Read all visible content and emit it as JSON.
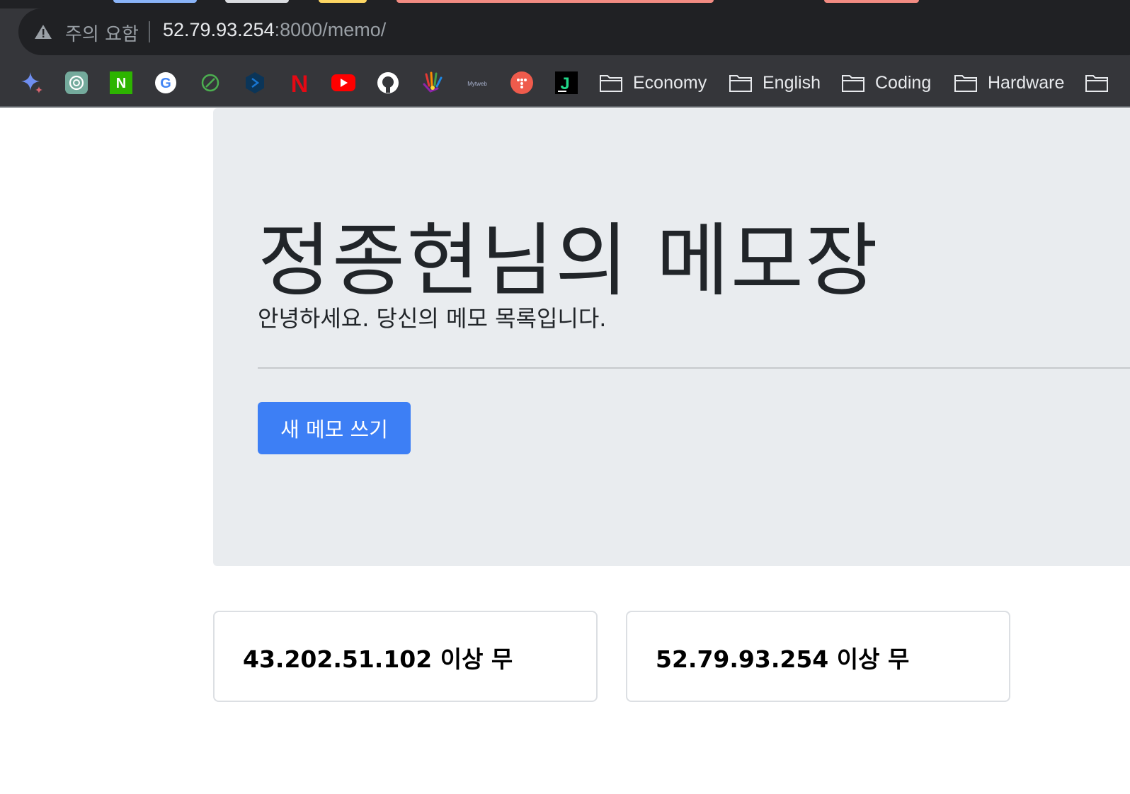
{
  "browser": {
    "security_label": "주의 요함",
    "url_host": "52.79.93.254",
    "url_path": ":8000/memo/",
    "bookmark_folders": [
      {
        "label": "Economy"
      },
      {
        "label": "English"
      },
      {
        "label": "Coding"
      },
      {
        "label": "Hardware"
      }
    ],
    "bookmark_icons": [
      "gemini-sparkle-icon",
      "chatgpt-icon",
      "naver-icon",
      "google-icon",
      "leaf-icon",
      "hexagon-icon",
      "netflix-icon",
      "youtube-icon",
      "github-icon",
      "hand-icon",
      "mytweb-icon",
      "dots-icon",
      "jetbrains-icon"
    ],
    "bookmark_texts": {
      "naver": "N",
      "google": "G",
      "netflix": "N",
      "mytweb": "Mytweb",
      "jetbrains": "J"
    }
  },
  "jumbotron": {
    "title": "정종현님의 메모장",
    "lead": "안녕하세요. 당신의 메모 목록입니다.",
    "new_memo_button": "새 메모 쓰기"
  },
  "memos": [
    {
      "title": "43.202.51.102 이상 무"
    },
    {
      "title": "52.79.93.254 이상 무"
    }
  ],
  "colors": {
    "chrome_bg": "#35363a",
    "jumbotron_bg": "#e9ecef",
    "primary": "#3d7ff5"
  }
}
